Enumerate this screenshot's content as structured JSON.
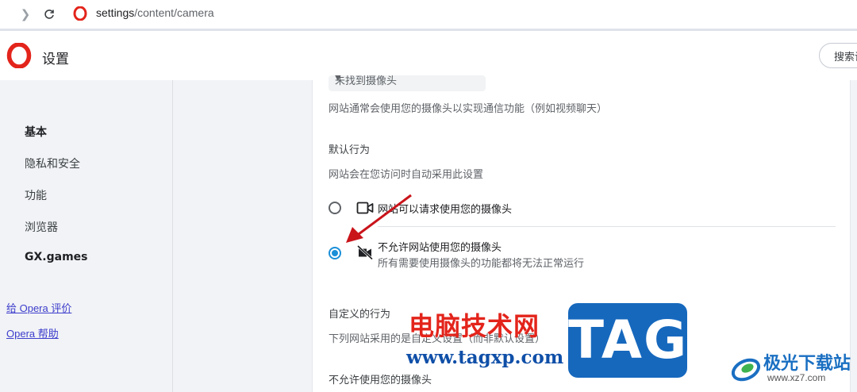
{
  "address_bar": {
    "url_host": "settings",
    "url_path": "/content/camera"
  },
  "header": {
    "title": "设置",
    "search_label": "搜索设置"
  },
  "sidebar": {
    "items": [
      {
        "label": "基本",
        "bold": true
      },
      {
        "label": "隐私和安全",
        "bold": false
      },
      {
        "label": "功能",
        "bold": false
      },
      {
        "label": "浏览器",
        "bold": false
      },
      {
        "label": "GX.games",
        "bold": true
      }
    ],
    "links": [
      {
        "label": "给 Opera 评价"
      },
      {
        "label": "Opera 帮助"
      }
    ]
  },
  "main": {
    "camera_select_value": "未找到摄像头",
    "intro": "网站通常会使用您的摄像头以实现通信功能（例如视频聊天）",
    "default_behavior": {
      "heading": "默认行为",
      "description": "网站会在您访问时自动采用此设置",
      "options": [
        {
          "label": "网站可以请求使用您的摄像头",
          "sublabel": "",
          "checked": false,
          "icon": "camera-icon"
        },
        {
          "label": "不允许网站使用您的摄像头",
          "sublabel": "所有需要使用摄像头的功能都将无法正常运行",
          "checked": true,
          "icon": "camera-off-icon"
        }
      ]
    },
    "custom_behavior": {
      "heading": "自定义的行为",
      "description": "下列网站采用的是自定义设置（而非默认设置）"
    },
    "blocked_heading": "不允许使用您的摄像头"
  },
  "watermark": {
    "site_cn": "电脑技术网",
    "site_url": "www.tagxp.com",
    "tag": "TAG",
    "brand_name": "极光下载站",
    "brand_url": "www.xz7.com"
  },
  "colors": {
    "accent": "#1a8fd8",
    "opera_red": "#e3241b",
    "link": "#3d3dcc"
  }
}
